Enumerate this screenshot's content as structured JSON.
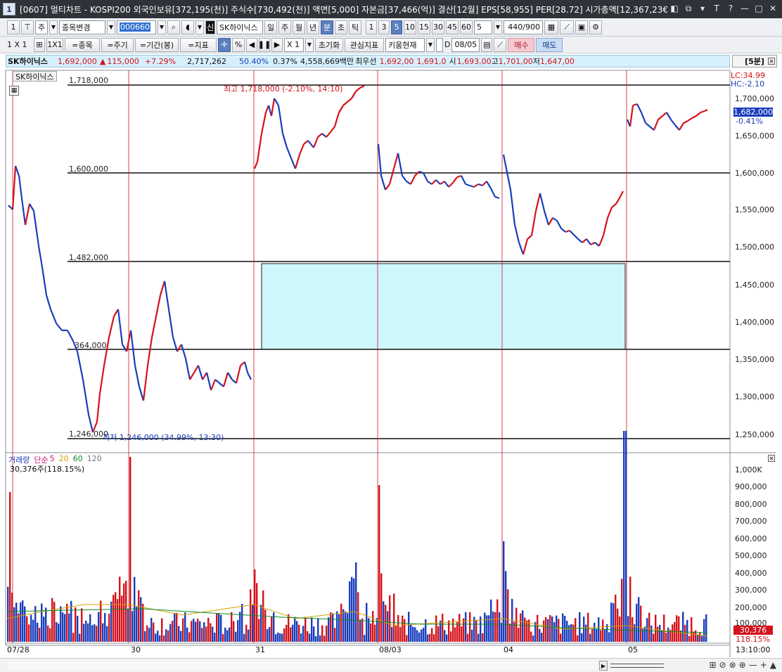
{
  "window": {
    "icon": "1",
    "title": "[0607] 멀티차트 - KOSPI200 외국인보유[372,195(천)] 주식수[730,492(천)] 액면[5,000] 자본금[37,466(억)] 결산[12월] EPS[58,955] PER[28.72] 시가총액[12,367,23€",
    "controls": [
      "◧",
      "⧉",
      "▾",
      "T",
      "?",
      "—",
      "□",
      "✕"
    ]
  },
  "toolbar1": {
    "num": "1",
    "market": "주",
    "change_stock": "종목변경",
    "code_selected": "000660",
    "stock_name": "SK하이닉스",
    "periods": [
      "일",
      "주",
      "월",
      "년",
      "분",
      "초",
      "틱"
    ],
    "selected_period": "분",
    "intervals": [
      "1",
      "3",
      "5",
      "10",
      "15",
      "30",
      "45",
      "60"
    ],
    "selected_interval": "5",
    "interval_value": "5",
    "count": "440/900"
  },
  "toolbar2": {
    "layout": "1 X 1",
    "layout_btn": "1X1",
    "stock_btn": "=종목",
    "cycle_btn": "=주기",
    "range_btn": "=기간(봉)",
    "indicator_btn": "=지표",
    "zoom": "X 1",
    "reset": "초기화",
    "watch": "관심지표",
    "kiwoom": "키움현재",
    "d_label": "D",
    "date": "08/05",
    "buy": "매수",
    "sell": "매도"
  },
  "quote": {
    "name": "SK하이닉스",
    "price": "1,692,000",
    "arrow": "▲",
    "change": "115,000",
    "rate": "+7.29%",
    "volume": "2,717,262",
    "ratio": "50.40%",
    "turnover": "0.37%",
    "amount": "4,558,669백만",
    "priority_label": "최우선",
    "ask": "1,692,00",
    "bid": "1,691,0",
    "open_label": "시",
    "open": "1,693,00",
    "high_label": "고",
    "high": "1,701,00",
    "low_label": "저",
    "low": "1,647,00",
    "period": "[5분]"
  },
  "chart": {
    "stock_tag": "SK하이닉스",
    "lc": "LC:34.99",
    "hc": "HC:-2.10",
    "current_price": "1,682,000",
    "current_change": "-0.41%",
    "high_annotation": "최고 1,718,000 (-2.10%, 14:10)",
    "low_annotation": "최저 1,246,000 (34.99%, 13:30)",
    "hlines": [
      "1,718,000",
      "1,600,000",
      "1,482,000",
      "364,000",
      "1,246,000"
    ],
    "price_axis": [
      "1,700,000",
      "1,650,000",
      "1,600,000",
      "1,550,000",
      "1,500,000",
      "1,450,000",
      "1,400,000",
      "1,350,000",
      "1,300,000",
      "1,250,000"
    ],
    "x_labels": [
      "07/28",
      "30",
      "31",
      "08/03",
      "04",
      "05"
    ],
    "time": "13:10:00",
    "colors": {
      "up": "#d4121b",
      "down": "#1a3dbb",
      "box": "#ccf7fb",
      "vline": "#d4121b"
    }
  },
  "volume": {
    "legend": {
      "name": "거래량",
      "ma": "단순",
      "m5": "5",
      "m20": "20",
      "m60": "60",
      "m120": "120"
    },
    "last": "30,376주(118.15%)",
    "axis": [
      "1,000K",
      "900,000",
      "800,000",
      "700,000",
      "600,000",
      "500,000",
      "400,000",
      "300,000",
      "200,000",
      "100,000"
    ],
    "current": "30,376",
    "current_pct": "118.15%"
  },
  "scrollbar": {
    "icons": [
      "⊞",
      "⊘",
      "⊗",
      "⊕",
      "—",
      "+",
      "▲"
    ]
  }
}
